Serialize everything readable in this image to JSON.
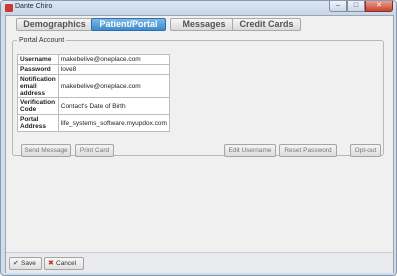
{
  "window": {
    "title": "Dante Chiro",
    "minimize_glyph": "–",
    "maximize_glyph": "□",
    "close_glyph": "✕"
  },
  "tabs": [
    {
      "label": "Demographics",
      "active": false
    },
    {
      "label": "Patient/Portal",
      "active": true
    },
    {
      "label": "Messages",
      "active": false
    },
    {
      "label": "Credit Cards",
      "active": false
    }
  ],
  "portal_account": {
    "legend": "Portal Account",
    "rows": [
      {
        "label": "Username",
        "value": "makebelive@oneplace.com"
      },
      {
        "label": "Password",
        "value": "love8"
      },
      {
        "label": "Notification email address",
        "value": "makebelive@oneplace.com"
      },
      {
        "label": "Verification Code",
        "value": "Contact's Date of Birth"
      },
      {
        "label": "Portal Address",
        "value": "life_systems_software.myupdox.com"
      }
    ]
  },
  "actions": {
    "send_message": "Send Message",
    "print_card": "Print Card",
    "edit_username": "Edit Username",
    "reset_password": "Reset Password",
    "opt_out": "Opt-out"
  },
  "footer": {
    "save": "Save",
    "cancel": "Cancel",
    "save_icon": "check-icon",
    "cancel_icon": "x-icon"
  }
}
